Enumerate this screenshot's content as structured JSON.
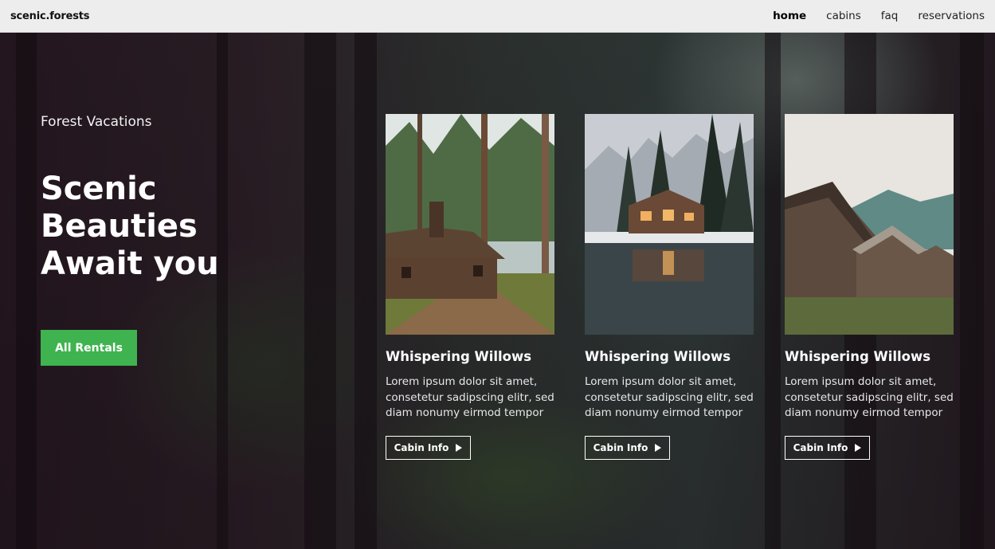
{
  "nav": {
    "brand": "scenic.forests",
    "links": [
      "home",
      "cabins",
      "faq",
      "reservations"
    ]
  },
  "hero": {
    "eyebrow": "Forest Vacations",
    "headline": [
      "Scenic",
      "Beauties",
      "Await you"
    ],
    "cta_label": "All Rentals"
  },
  "cards": [
    {
      "title": "Whispering Willows",
      "text": "Lorem ipsum dolor sit amet, consetetur sadipscing elitr, sed diam nonumy eirmod tempor",
      "button": "Cabin Info"
    },
    {
      "title": "Whispering Willows",
      "text": "Lorem ipsum dolor sit amet, consetetur sadipscing elitr, sed diam nonumy eirmod tempor",
      "button": "Cabin Info"
    },
    {
      "title": "Whispering Willows",
      "text": "Lorem ipsum dolor sit amet, consetetur sadipscing elitr, sed diam nonumy eirmod tempor",
      "button": "Cabin Info"
    }
  ],
  "colors": {
    "accent": "#3fb34f",
    "nav_bg": "#ededed"
  }
}
